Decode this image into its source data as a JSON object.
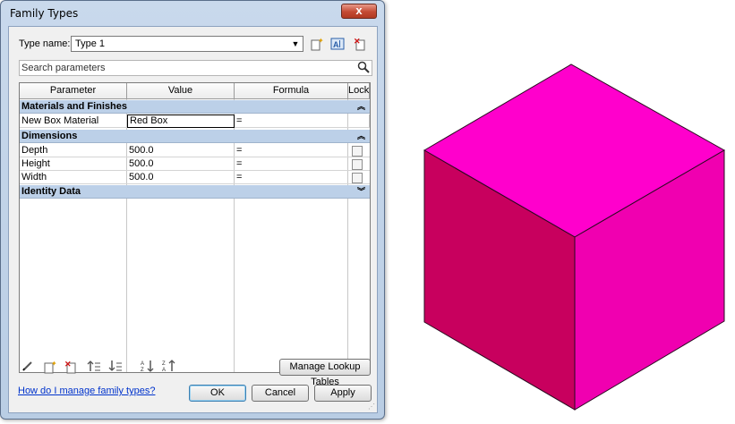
{
  "dialog": {
    "title": "Family Types",
    "close_label": "x",
    "type_name_label": "Type name:",
    "type_name_value": "Type 1",
    "search_placeholder": "Search parameters",
    "columns": {
      "parameter": "Parameter",
      "value": "Value",
      "formula": "Formula",
      "lock": "Lock"
    },
    "groups": {
      "materials": {
        "label": "Materials and Finishes",
        "state": "expanded"
      },
      "dimensions": {
        "label": "Dimensions",
        "state": "expanded"
      },
      "identity": {
        "label": "Identity Data",
        "state": "collapsed"
      }
    },
    "rows": {
      "material": {
        "parameter": "New Box Material",
        "value": "Red Box",
        "formula": "="
      },
      "depth": {
        "parameter": "Depth",
        "value": "500.0",
        "formula": "=",
        "locked": false
      },
      "height": {
        "parameter": "Height",
        "value": "500.0",
        "formula": "=",
        "locked": false
      },
      "width": {
        "parameter": "Width",
        "value": "500.0",
        "formula": "=",
        "locked": false
      }
    },
    "manage_lookup_label": "Manage Lookup Tables",
    "help_link": "How do I manage family types?",
    "ok_label": "OK",
    "cancel_label": "Cancel",
    "apply_label": "Apply"
  },
  "icons": {
    "new_type": "new-type-icon",
    "rename_type": "rename-type-icon",
    "delete_type": "delete-type-icon",
    "search": "search-icon",
    "edit_param": "pencil-icon",
    "new_param": "new-parameter-icon",
    "delete_param": "delete-parameter-icon",
    "move_up": "move-up-icon",
    "move_down": "move-down-icon",
    "sort_asc": "sort-ascending-icon",
    "sort_desc": "sort-descending-icon"
  },
  "colors": {
    "cube_top": "#ff00cc",
    "cube_left": "#c8005e",
    "cube_right": "#f000b0",
    "group_header": "#bcd0e8",
    "link": "#0033cc"
  }
}
